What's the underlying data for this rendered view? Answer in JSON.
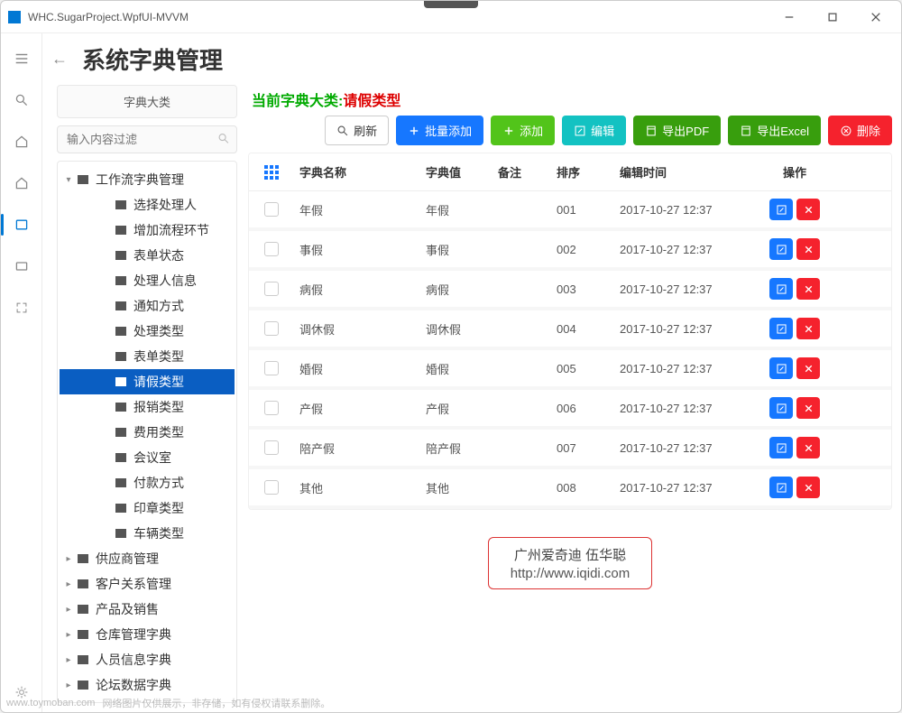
{
  "window": {
    "title": "WHC.SugarProject.WpfUI-MVVM"
  },
  "page": {
    "title": "系统字典管理"
  },
  "sidebar": {
    "category_label": "字典大类",
    "filter_placeholder": "输入内容过滤",
    "tree": [
      {
        "label": "工作流字典管理",
        "level": 0,
        "expanded": true,
        "children": [
          {
            "label": "选择处理人",
            "level": 1
          },
          {
            "label": "增加流程环节",
            "level": 1
          },
          {
            "label": "表单状态",
            "level": 1
          },
          {
            "label": "处理人信息",
            "level": 1
          },
          {
            "label": "通知方式",
            "level": 1
          },
          {
            "label": "处理类型",
            "level": 1
          },
          {
            "label": "表单类型",
            "level": 1
          },
          {
            "label": "请假类型",
            "level": 1,
            "selected": true
          },
          {
            "label": "报销类型",
            "level": 1
          },
          {
            "label": "费用类型",
            "level": 1
          },
          {
            "label": "会议室",
            "level": 1
          },
          {
            "label": "付款方式",
            "level": 1
          },
          {
            "label": "印章类型",
            "level": 1
          },
          {
            "label": "车辆类型",
            "level": 1
          }
        ]
      },
      {
        "label": "供应商管理",
        "level": 0,
        "expanded": false
      },
      {
        "label": "客户关系管理",
        "level": 0,
        "expanded": false
      },
      {
        "label": "产品及销售",
        "level": 0,
        "expanded": false
      },
      {
        "label": "仓库管理字典",
        "level": 0,
        "expanded": false
      },
      {
        "label": "人员信息字典",
        "level": 0,
        "expanded": false
      },
      {
        "label": "论坛数据字典",
        "level": 0,
        "expanded": false
      }
    ]
  },
  "breadcrumb": {
    "prefix": "当前字典大类:",
    "value": "请假类型"
  },
  "toolbar": {
    "refresh": "刷新",
    "batch_add": "批量添加",
    "add": "添加",
    "edit": "编辑",
    "export_pdf": "导出PDF",
    "export_excel": "导出Excel",
    "delete": "删除"
  },
  "table": {
    "headers": {
      "name": "字典名称",
      "value": "字典值",
      "remark": "备注",
      "sort": "排序",
      "edit_time": "编辑时间",
      "ops": "操作"
    },
    "rows": [
      {
        "name": "年假",
        "value": "年假",
        "remark": "",
        "sort": "001",
        "edit_time": "2017-10-27 12:37"
      },
      {
        "name": "事假",
        "value": "事假",
        "remark": "",
        "sort": "002",
        "edit_time": "2017-10-27 12:37"
      },
      {
        "name": "病假",
        "value": "病假",
        "remark": "",
        "sort": "003",
        "edit_time": "2017-10-27 12:37"
      },
      {
        "name": "调休假",
        "value": "调休假",
        "remark": "",
        "sort": "004",
        "edit_time": "2017-10-27 12:37"
      },
      {
        "name": "婚假",
        "value": "婚假",
        "remark": "",
        "sort": "005",
        "edit_time": "2017-10-27 12:37"
      },
      {
        "name": "产假",
        "value": "产假",
        "remark": "",
        "sort": "006",
        "edit_time": "2017-10-27 12:37"
      },
      {
        "name": "陪产假",
        "value": "陪产假",
        "remark": "",
        "sort": "007",
        "edit_time": "2017-10-27 12:37"
      },
      {
        "name": "其他",
        "value": "其他",
        "remark": "",
        "sort": "008",
        "edit_time": "2017-10-27 12:37"
      }
    ]
  },
  "watermark": {
    "line1": "广州爱奇迪 伍华聪",
    "line2": "http://www.iqidi.com"
  },
  "footer": {
    "domain": "www.toymoban.com",
    "text": "网络图片仅供展示，非存储，如有侵权请联系删除。"
  }
}
